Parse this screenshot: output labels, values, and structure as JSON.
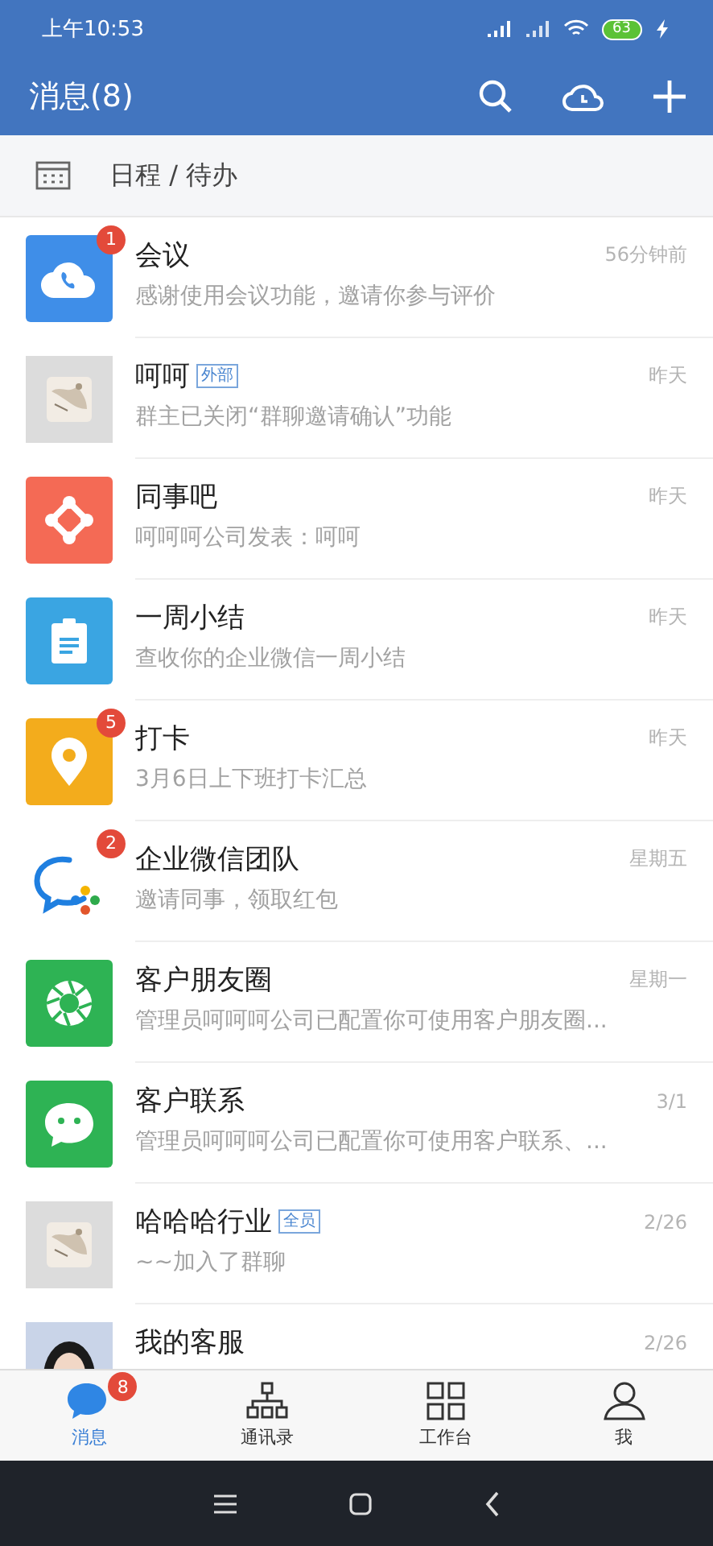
{
  "status_bar": {
    "time": "上午10:53",
    "battery": "63"
  },
  "header": {
    "title": "消息(8)"
  },
  "schedule": {
    "label": "日程 / 待办"
  },
  "messages": [
    {
      "title": "会议",
      "preview": "感谢使用会议功能，邀请你参与评价",
      "time": "56分钟前",
      "badge": "1"
    },
    {
      "title": "呵呵",
      "tag": "外部",
      "preview": "群主已关闭“群聊邀请确认”功能",
      "time": "昨天",
      "kind": "picture"
    },
    {
      "title": "同事吧",
      "preview": "呵呵呵公司发表：呵呵",
      "time": "昨天"
    },
    {
      "title": "一周小结",
      "preview": "查收你的企业微信一周小结",
      "time": "昨天"
    },
    {
      "title": "打卡",
      "preview": "3月6日上下班打卡汇总",
      "time": "昨天",
      "badge": "5"
    },
    {
      "title": "企业微信团队",
      "preview": "邀请同事，领取红包",
      "time": "星期五",
      "badge": "2"
    },
    {
      "title": "客户朋友圈",
      "preview": "管理员呵呵呵公司已配置你可使用客户朋友圈...",
      "time": "星期一"
    },
    {
      "title": "客户联系",
      "preview": "管理员呵呵呵公司已配置你可使用客户联系、...",
      "time": "3/1"
    },
    {
      "title": "哈哈哈行业",
      "tag": "全员",
      "preview": "~~加入了群聊",
      "time": "2/26",
      "kind": "picture"
    },
    {
      "title": "我的客服",
      "time": "2/26",
      "kind": "person"
    }
  ],
  "tabs": [
    {
      "label": "消息",
      "selected": true,
      "badge": "8"
    },
    {
      "label": "通讯录",
      "selected": false
    },
    {
      "label": "工作台",
      "selected": false
    },
    {
      "label": "我",
      "selected": false
    }
  ]
}
